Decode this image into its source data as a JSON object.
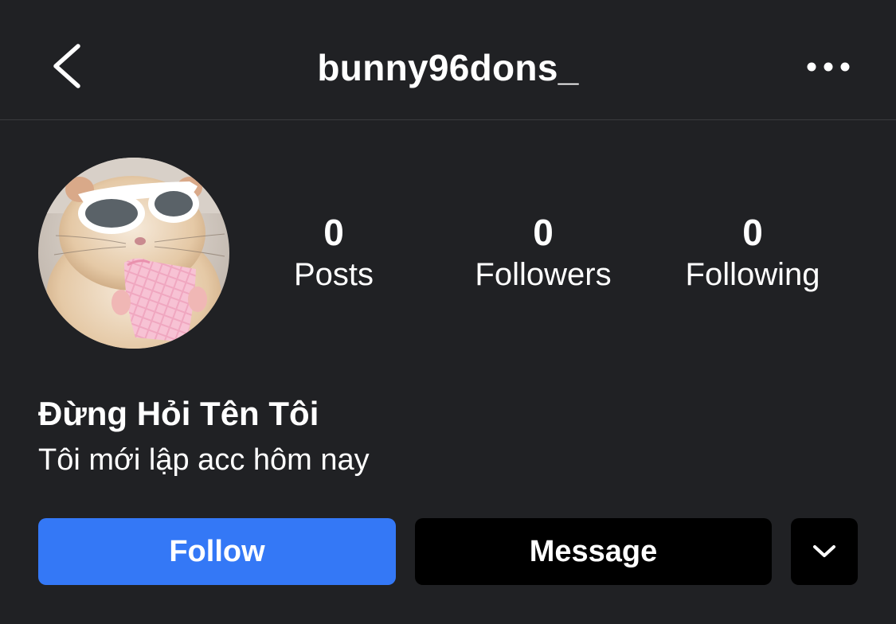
{
  "header": {
    "username": "bunny96dons_",
    "back_icon": "chevron-left-icon",
    "more_icon": "more-horizontal-icon"
  },
  "profile": {
    "avatar_alt": "hamster-wearing-sunglasses-eating-wafer",
    "stats": {
      "posts": {
        "count": "0",
        "label": "Posts"
      },
      "followers": {
        "count": "0",
        "label": "Followers"
      },
      "following": {
        "count": "0",
        "label": "Following"
      }
    },
    "display_name": "Đừng Hỏi Tên Tôi",
    "bio": "Tôi mới lập acc hôm nay"
  },
  "actions": {
    "follow_label": "Follow",
    "message_label": "Message",
    "dropdown_icon": "chevron-down-icon"
  },
  "colors": {
    "background": "#202124",
    "follow_button": "#3478f6",
    "secondary_button": "#000000",
    "text": "#ffffff",
    "divider": "#3a3b3e"
  }
}
